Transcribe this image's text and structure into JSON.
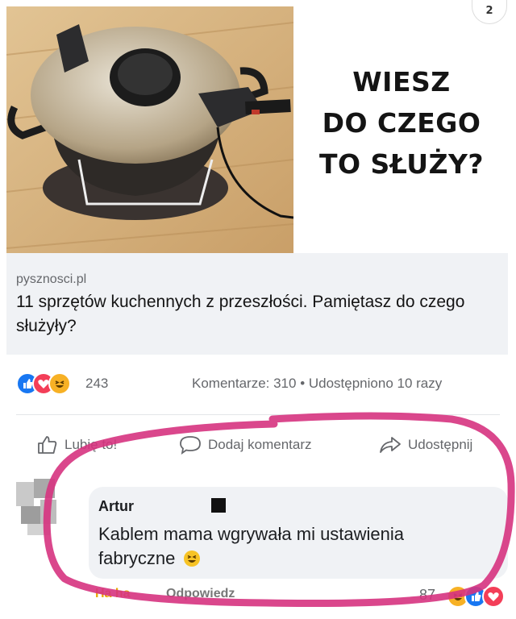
{
  "preview": {
    "headline_lines": [
      "WIESZ",
      "DO CZEGO",
      "TO SŁUŻY?"
    ],
    "domain": "pysznosci.pl",
    "title": "11 sprzętów kuchennych z przeszłości. Pamiętasz do czego służyły?"
  },
  "top_badge": "2",
  "stats": {
    "reaction_count": "243",
    "comments_shares": "Komentarze: 310 • Udostępniono 10 razy"
  },
  "actions": {
    "like": "Lubię to!",
    "comment": "Dodaj komentarz",
    "share": "Udostępnij"
  },
  "comment": {
    "author": "Artur",
    "text": "Kablem mama wgrywała mi ustawienia fabryczne",
    "like_link": "Ha ha",
    "reply_link": "Odpowiedz",
    "reaction_count": "87"
  },
  "colors": {
    "like": "#1877f2",
    "love": "#f33e58",
    "haha": "#f7b125",
    "marker": "#d6337f"
  }
}
